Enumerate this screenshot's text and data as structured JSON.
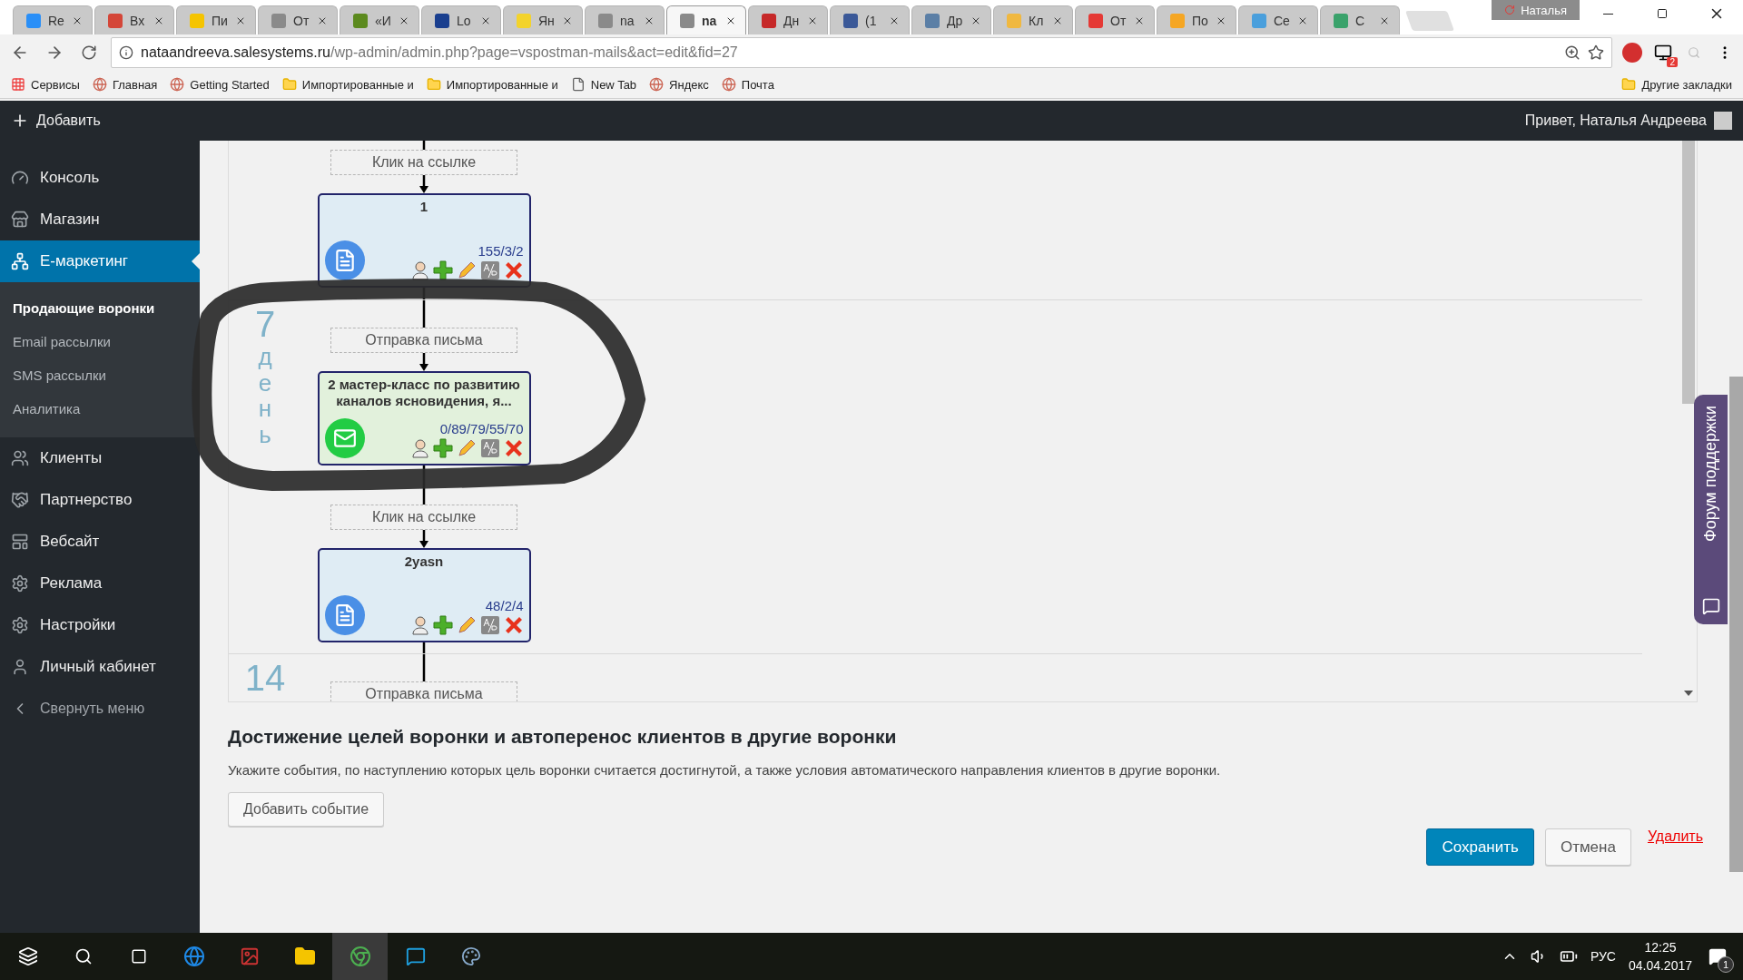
{
  "browser": {
    "tabs": [
      {
        "title": "Re",
        "selected": false,
        "color": "#2a8ff7"
      },
      {
        "title": "Вх",
        "selected": false,
        "color": "#d44638"
      },
      {
        "title": "Пи",
        "selected": false,
        "color": "#f5c400"
      },
      {
        "title": "От",
        "selected": false,
        "color": "#8a8a8a"
      },
      {
        "title": "«И",
        "selected": false,
        "color": "#5c8a1e"
      },
      {
        "title": "Lo",
        "selected": false,
        "color": "#1a3f8f"
      },
      {
        "title": "Ян",
        "selected": false,
        "color": "#f3d32c"
      },
      {
        "title": "na",
        "selected": false,
        "color": "#8a8a8a"
      },
      {
        "title": "na",
        "selected": true,
        "color": "#8a8a8a"
      },
      {
        "title": "Дн",
        "selected": false,
        "color": "#c62828"
      },
      {
        "title": "(1",
        "selected": false,
        "color": "#3b5998"
      },
      {
        "title": "Др",
        "selected": false,
        "color": "#5b7fa6"
      },
      {
        "title": "Кл",
        "selected": false,
        "color": "#f0b840"
      },
      {
        "title": "От",
        "selected": false,
        "color": "#e53935"
      },
      {
        "title": "По",
        "selected": false,
        "color": "#f5a623"
      },
      {
        "title": "Се",
        "selected": false,
        "color": "#4a9fdc"
      },
      {
        "title": "С",
        "selected": false,
        "color": "#3aa26b"
      }
    ],
    "profile": "Наталья",
    "address": {
      "host": "nataandreeva.salesystems.ru",
      "path": "/wp-admin/admin.php?page=vspostman-mails&act=edit&fid=27"
    },
    "extension_badge": "2",
    "bookmarks": [
      {
        "kind": "apps",
        "label": "Сервисы"
      },
      {
        "kind": "site",
        "label": "Главная"
      },
      {
        "kind": "site",
        "label": "Getting Started"
      },
      {
        "kind": "folder",
        "label": "Импортированные и"
      },
      {
        "kind": "folder",
        "label": "Импортированные и"
      },
      {
        "kind": "page",
        "label": "New Tab"
      },
      {
        "kind": "site",
        "label": "Яндекс"
      },
      {
        "kind": "site",
        "label": "Почта"
      }
    ],
    "other_bookmarks": "Другие закладки"
  },
  "admin_bar": {
    "add": "Добавить",
    "greeting": "Привет, Наталья Андреева"
  },
  "sidebar": {
    "items": [
      {
        "label": "Консоль",
        "selected": false
      },
      {
        "label": "Магазин",
        "selected": false
      },
      {
        "label": "Е-маркетинг",
        "selected": true,
        "children": [
          {
            "label": "Продающие воронки",
            "selected": true
          },
          {
            "label": "Email рассылки",
            "selected": false
          },
          {
            "label": "SMS рассылки",
            "selected": false
          },
          {
            "label": "Аналитика",
            "selected": false
          }
        ]
      },
      {
        "label": "Клиенты",
        "selected": false
      },
      {
        "label": "Партнерство",
        "selected": false
      },
      {
        "label": "Вебсайт",
        "selected": false
      },
      {
        "label": "Реклама",
        "selected": false
      },
      {
        "label": "Настройки",
        "selected": false
      },
      {
        "label": "Личный кабинет",
        "selected": false
      }
    ],
    "collapse": "Свернуть меню"
  },
  "funnel": {
    "sections": [
      {
        "steps": [
          {
            "kind": "trigger",
            "label": "Клик на ссылке"
          },
          {
            "kind": "page",
            "title": "1",
            "stats": "155/3/2"
          }
        ]
      },
      {
        "day": "7",
        "day_word": "день",
        "steps": [
          {
            "kind": "trigger",
            "label": "Отправка письма"
          },
          {
            "kind": "email",
            "title": "2 мастер-класс по развитию каналов ясновидения, я...",
            "stats": "0/89/79/55/70"
          },
          {
            "kind": "trigger",
            "label": "Клик на ссылке"
          },
          {
            "kind": "page",
            "title": "2yasn",
            "stats": "48/2/4"
          }
        ]
      },
      {
        "day": "14",
        "steps": [
          {
            "kind": "trigger",
            "label": "Отправка письма"
          }
        ]
      }
    ]
  },
  "goals": {
    "title": "Достижение целей воронки и автоперенос клиентов в другие воронки",
    "description": "Укажите события, по наступлению которых цель воронки считается достигнутой, а также условия автоматического направления клиентов в другие воронки.",
    "add_button": "Добавить событие"
  },
  "actions": {
    "save": "Сохранить",
    "cancel": "Отмена",
    "delete": "Удалить"
  },
  "support_tab": "Форум поддержки",
  "taskbar": {
    "language": "РУС",
    "time": "12:25",
    "date": "04.04.2017",
    "notifications": "1"
  }
}
